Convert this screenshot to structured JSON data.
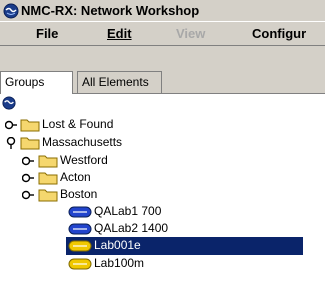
{
  "window": {
    "title": "NMC-RX: Network Workshop"
  },
  "menu": {
    "file": {
      "label": "File"
    },
    "edit": {
      "label": "Edit"
    },
    "view": {
      "label": "View"
    },
    "configure": {
      "label": "Configur"
    }
  },
  "tabs": [
    {
      "label": "Groups",
      "active": true
    },
    {
      "label": "All Elements",
      "active": false
    }
  ],
  "tree": {
    "root": {
      "icon": "network-globe-icon"
    },
    "nodes": [
      {
        "label": "Lost & Found",
        "type": "folder",
        "expander": "collapsed"
      },
      {
        "label": "Massachusetts",
        "type": "folder",
        "expander": "expanded"
      },
      {
        "label": "Westford",
        "type": "folder",
        "expander": "collapsed"
      },
      {
        "label": "Acton",
        "type": "folder",
        "expander": "collapsed"
      },
      {
        "label": "Boston",
        "type": "folder",
        "expander": "collapsed"
      },
      {
        "label": "QALab1 700",
        "type": "device",
        "color": "#2244cc"
      },
      {
        "label": "QALab2 1400",
        "type": "device",
        "color": "#2244cc"
      },
      {
        "label": "Lab001e",
        "type": "device",
        "color": "#f0c800",
        "selected": true
      },
      {
        "label": "Lab100m",
        "type": "device",
        "color": "#f0c800"
      }
    ]
  },
  "colors": {
    "selection": "#0a246a",
    "chrome": "#d4d0c8"
  }
}
